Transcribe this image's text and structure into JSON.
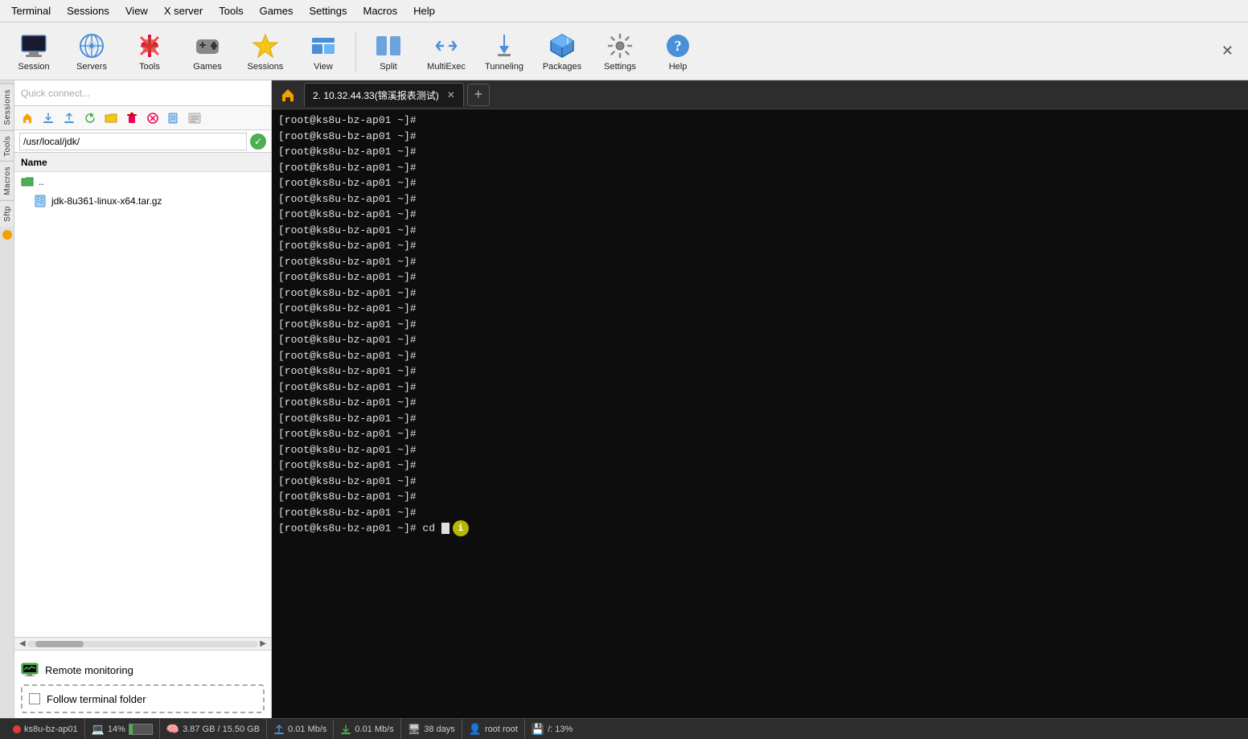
{
  "menubar": {
    "items": [
      "Terminal",
      "Sessions",
      "View",
      "X server",
      "Tools",
      "Games",
      "Settings",
      "Macros",
      "Help"
    ]
  },
  "toolbar": {
    "buttons": [
      {
        "label": "Session",
        "icon": "🖥"
      },
      {
        "label": "Servers",
        "icon": "🔵"
      },
      {
        "label": "Tools",
        "icon": "🔧"
      },
      {
        "label": "Games",
        "icon": "🎮"
      },
      {
        "label": "Sessions",
        "icon": "⭐"
      },
      {
        "label": "View",
        "icon": "🔷"
      },
      {
        "label": "Split",
        "icon": "⊞"
      },
      {
        "label": "MultiExec",
        "icon": "⇌"
      },
      {
        "label": "Tunneling",
        "icon": "⬇"
      },
      {
        "label": "Packages",
        "icon": "📦"
      },
      {
        "label": "Settings",
        "icon": "⚙"
      },
      {
        "label": "Help",
        "icon": "❓"
      }
    ]
  },
  "left_panel": {
    "quick_connect_placeholder": "Quick connect...",
    "path": "/usr/local/jdk/",
    "column_header": "Name",
    "files": [
      {
        "name": "..",
        "icon": "📁",
        "indent": false
      },
      {
        "name": "jdk-8u361-linux-x64.tar.gz",
        "icon": "📄",
        "indent": true
      }
    ],
    "remote_monitoring_label": "Remote monitoring",
    "follow_folder_label": "Follow terminal folder"
  },
  "terminal": {
    "tab_label": "2. 10.32.44.33(锦溪报表测试)",
    "prompt": "[root@ks8u-bz-ap01 ~]#",
    "lines_count": 27,
    "last_command": "cd",
    "info_icon": "i"
  },
  "statusbar": {
    "hostname": "ks8u-bz-ap01",
    "cpu_percent": "14%",
    "cpu_bar_fill": 14,
    "memory": "3.87 GB / 15.50 GB",
    "upload": "0.01 Mb/s",
    "download": "0.01 Mb/s",
    "uptime": "38 days",
    "user": "root root",
    "path_info": "/: 13%"
  },
  "vtabs": [
    "Sessions",
    "Tools",
    "Macros",
    "Sftp"
  ]
}
